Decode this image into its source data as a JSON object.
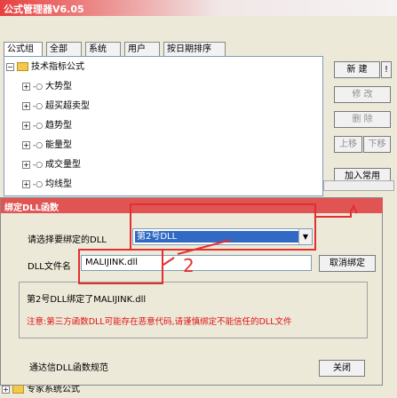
{
  "window": {
    "title": "公式管理器V6.05"
  },
  "tabs": [
    "公式组",
    "全部",
    "系统",
    "用户",
    "按日期排序"
  ],
  "tree": {
    "root": "技术指标公式",
    "items": [
      "大势型",
      "超买超卖型",
      "趋势型",
      "能量型",
      "成交量型",
      "均线型"
    ]
  },
  "right_buttons": {
    "new": "新 建",
    "edit": "修 改",
    "delete": "删 除",
    "up": "上移",
    "down": "下移",
    "add_common": "加入常用"
  },
  "bottom_tree": {
    "label": "专家系统公式"
  },
  "dialog": {
    "title": "绑定DLL函数",
    "select_label": "请选择要绑定的DLL",
    "selected": "第2号DLL",
    "file_label": "DLL文件名",
    "file_value": "MALIJINK.dll",
    "cancel_bind": "取消绑定",
    "status": "第2号DLL绑定了MALIJINK.dll",
    "note": "注意:第三方函数DLL可能存在恶意代码,请谨慎绑定不能信任的DLL文件",
    "checkbox_label": "通达信DLL函数规范",
    "close": "关闭"
  },
  "annotation": {
    "marker": "2"
  },
  "colors": {
    "title_red": "#e05454",
    "note_red": "#e01010",
    "selection": "#316ac5"
  }
}
